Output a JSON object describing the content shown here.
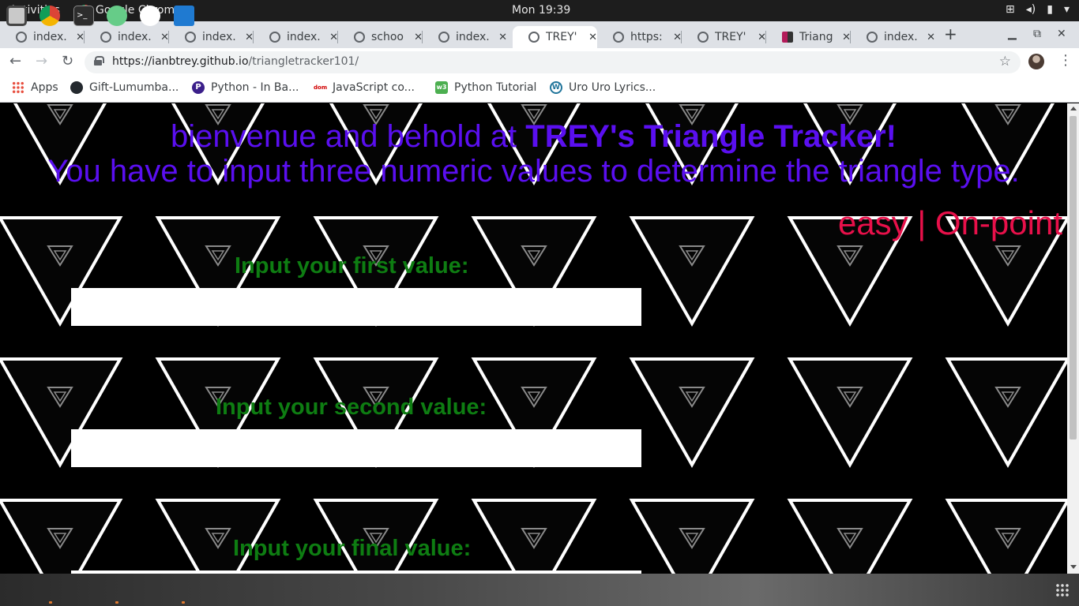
{
  "topbar": {
    "activities": "Activities",
    "app_name": "Google Chrome",
    "clock": "Mon 19:39"
  },
  "tabs": [
    {
      "title": "index."
    },
    {
      "title": "index."
    },
    {
      "title": "index."
    },
    {
      "title": "index."
    },
    {
      "title": "schoo"
    },
    {
      "title": "index."
    },
    {
      "title": "TREY'"
    },
    {
      "title": "https:"
    },
    {
      "title": "TREY'"
    },
    {
      "title": "Triang"
    },
    {
      "title": "index."
    }
  ],
  "new_tab_label": "+",
  "toolbar": {
    "url_host": "https://ianbtrey.github.io",
    "url_path": "/triangletracker101/"
  },
  "bookmarks": [
    {
      "label": "Apps",
      "icon": "apps-grid-icon"
    },
    {
      "label": "Gift-Lumumba...",
      "icon": "github-icon"
    },
    {
      "label": "Python - In Ba...",
      "icon": "python-icon"
    },
    {
      "label": "JavaScript co...",
      "icon": "javascript-icon"
    },
    {
      "label": "Python Tutorial",
      "icon": "w3schools-icon"
    },
    {
      "label": "Uro Uro Lyrics...",
      "icon": "wordpress-icon"
    }
  ],
  "page": {
    "headline_prefix": "bienvenue and behold at ",
    "headline_bold": "TREY's Triangle Tracker!",
    "subheadline": "You have to input three numeric values to determine the triangle type.",
    "nav_links": "easy | On-point",
    "label_first": "Input your first value:",
    "label_second": "Input your second value:",
    "label_final": "Input your final value:",
    "colors": {
      "headline": "#5a0ff0",
      "nav_links": "#e8104a",
      "labels": "#0e7d12"
    }
  }
}
